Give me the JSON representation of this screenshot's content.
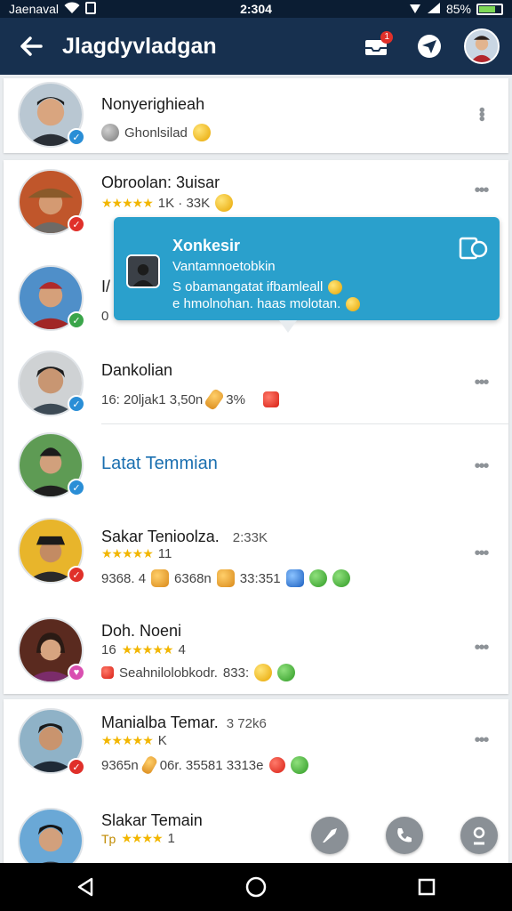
{
  "status_bar": {
    "carrier": "Jaenaval",
    "time": "2:304",
    "battery": "85%"
  },
  "app_bar": {
    "title": "Jlagdyvladgan",
    "notification_count": "1"
  },
  "contacts": [
    {
      "name": "Nonyerighieah",
      "sub_text": "Ghonlsilad",
      "stars": "",
      "badge_color": "#2a8ed6"
    },
    {
      "name": "Obroolan: 3uisar",
      "sub_text": "1K · 33K",
      "stars": "★★★★★",
      "badge_color": "#e0302a"
    },
    {
      "name": "I/",
      "sub_text": "0",
      "stars": "",
      "badge_color": "#3aa54a"
    },
    {
      "name": "Dankolian",
      "sub_text": "16: 20ljak1 3,50n",
      "extra": "3%",
      "stars": "",
      "badge_color": "#2a8ed6"
    },
    {
      "name": "Latat Temmian",
      "sub_text": "",
      "stars": "",
      "badge_color": "#2a8ed6",
      "highlight": true
    },
    {
      "name": "Sakar Tenioolza.",
      "name_extra": "2:33K",
      "sub_text": "9368. 4",
      "sub_text2": "6368n",
      "sub_text3": "33:351",
      "stars": "★★★★★",
      "stars_suffix": "11",
      "badge_color": "#e0302a"
    },
    {
      "name": "Doh. Noeni",
      "sub_text": "Seahnilolobkodr.",
      "sub_text2": "833:",
      "stars": "★★★★★",
      "stars_prefix": "16",
      "stars_suffix": "4",
      "badge_color": "#d94fb0"
    },
    {
      "name": "Manialba Temar.",
      "name_extra": "3 72k6",
      "sub_text": "9365n",
      "sub_text2": "06r. 35581 3313e",
      "stars": "★★★★★",
      "stars_suffix": "K",
      "badge_color": "#e0302a"
    },
    {
      "name": "Slakar Temain",
      "sub_text": "",
      "stars": "★★★★",
      "stars_prefix": "Tp",
      "stars_suffix": "1",
      "badge_color": "#e0302a"
    }
  ],
  "popup": {
    "title": "Xonkesir",
    "line1": "Vantamnoetobkin",
    "line2": "S obamangatat ifbamleall",
    "line3": "e hmolnohan. haas molotan."
  },
  "colors": {
    "app_bar": "#17304f",
    "status_bar": "#0b1d33",
    "popup": "#2aa0cc",
    "accent_link": "#1a6fb0"
  }
}
